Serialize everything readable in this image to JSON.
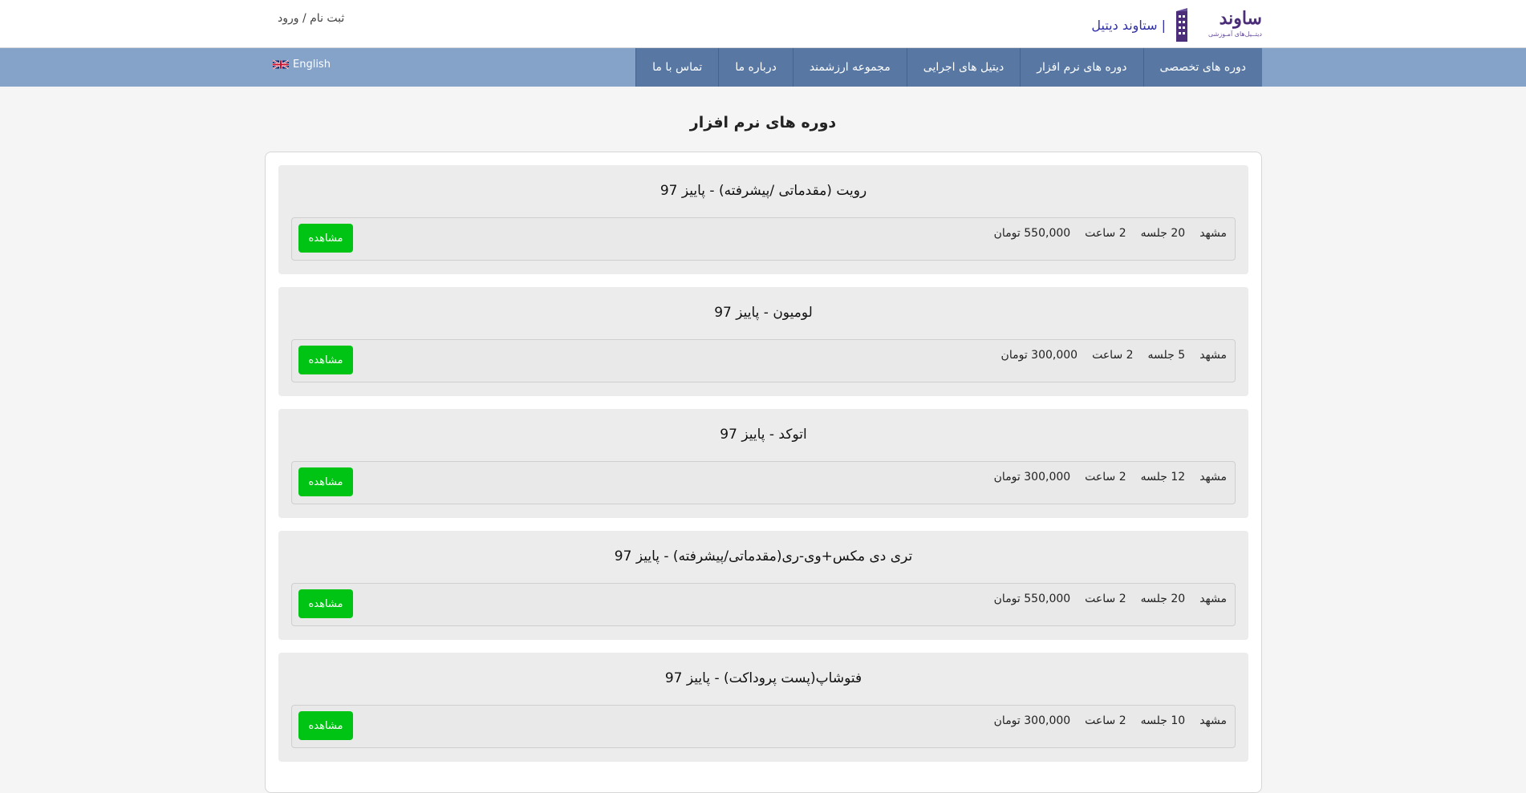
{
  "header": {
    "auth_text": "ثبت نام / ورود",
    "logo_word": "ساوند",
    "logo_sub": "دیتــیل‌های آمـوزشی",
    "brand_name": "| ستاوند دیتیل"
  },
  "nav": {
    "language": "English",
    "items": [
      {
        "label": "دوره های تخصصی"
      },
      {
        "label": "دوره های نرم افزار"
      },
      {
        "label": "دیتیل های اجرایی"
      },
      {
        "label": "مجموعه ارزشمند"
      },
      {
        "label": "درباره ما"
      },
      {
        "label": "تماس با ما"
      }
    ]
  },
  "page": {
    "title": "دوره های نرم افزار"
  },
  "courses": [
    {
      "title": "رویت (مقدماتی /پیشرفته) - پاییز 97",
      "city": "مشهد",
      "sessions": "20 جلسه",
      "duration": "2 ساعت",
      "price": "550,000 تومان",
      "button": "مشاهده"
    },
    {
      "title": "لومیون - پاییز 97",
      "city": "مشهد",
      "sessions": "5 جلسه",
      "duration": "2 ساعت",
      "price": "300,000 تومان",
      "button": "مشاهده"
    },
    {
      "title": "اتوکد - پاییز 97",
      "city": "مشهد",
      "sessions": "12 جلسه",
      "duration": "2 ساعت",
      "price": "300,000 تومان",
      "button": "مشاهده"
    },
    {
      "title": "تری دی مکس+وی-ری(مقدماتی/پیشرفته) - پاییز 97",
      "city": "مشهد",
      "sessions": "20 جلسه",
      "duration": "2 ساعت",
      "price": "550,000 تومان",
      "button": "مشاهده"
    },
    {
      "title": "فتوشاپ(پست پروداکت) - پاییز 97",
      "city": "مشهد",
      "sessions": "10 جلسه",
      "duration": "2 ساعت",
      "price": "300,000 تومان",
      "button": "مشاهده"
    }
  ],
  "colors": {
    "nav_bar": "#85a2c8",
    "nav_item": "#5878a3",
    "button": "#00c414",
    "brand": "#2f2fa8"
  }
}
